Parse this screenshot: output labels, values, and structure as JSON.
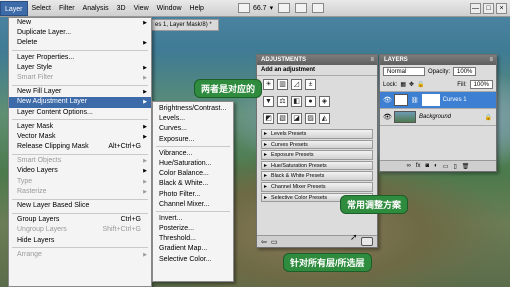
{
  "menubar": {
    "items": [
      "Layer",
      "Select",
      "Filter",
      "Analysis",
      "3D",
      "View",
      "Window",
      "Help"
    ],
    "zoom": "66.7",
    "window_controls": [
      "—",
      "□",
      "×"
    ]
  },
  "doc_tab": "es 1, Layer Mask/8) *",
  "layer_menu": {
    "items": [
      {
        "label": "New",
        "arrow": true
      },
      {
        "label": "Duplicate Layer..."
      },
      {
        "label": "Delete",
        "arrow": true
      },
      {
        "sep": true
      },
      {
        "label": "Layer Properties..."
      },
      {
        "label": "Layer Style",
        "arrow": true
      },
      {
        "label": "Smart Filter",
        "arrow": true,
        "disabled": true
      },
      {
        "sep": true
      },
      {
        "label": "New Fill Layer",
        "arrow": true
      },
      {
        "label": "New Adjustment Layer",
        "arrow": true,
        "highlight": true
      },
      {
        "label": "Layer Content Options..."
      },
      {
        "sep": true
      },
      {
        "label": "Layer Mask",
        "arrow": true
      },
      {
        "label": "Vector Mask",
        "arrow": true
      },
      {
        "label": "Release Clipping Mask",
        "shortcut": "Alt+Ctrl+G"
      },
      {
        "sep": true
      },
      {
        "label": "Smart Objects",
        "arrow": true,
        "disabled": true
      },
      {
        "label": "Video Layers",
        "arrow": true
      },
      {
        "label": "Type",
        "arrow": true,
        "disabled": true
      },
      {
        "label": "Rasterize",
        "arrow": true,
        "disabled": true
      },
      {
        "sep": true
      },
      {
        "label": "New Layer Based Slice"
      },
      {
        "sep": true
      },
      {
        "label": "Group Layers",
        "shortcut": "Ctrl+G"
      },
      {
        "label": "Ungroup Layers",
        "shortcut": "Shift+Ctrl+G",
        "disabled": true
      },
      {
        "label": "Hide Layers"
      },
      {
        "sep": true
      },
      {
        "label": "Arrange",
        "arrow": true,
        "disabled": true
      }
    ]
  },
  "adjustment_submenu": {
    "items": [
      {
        "label": "Brightness/Contrast..."
      },
      {
        "label": "Levels..."
      },
      {
        "label": "Curves..."
      },
      {
        "label": "Exposure..."
      },
      {
        "sep": true
      },
      {
        "label": "Vibrance..."
      },
      {
        "label": "Hue/Saturation..."
      },
      {
        "label": "Color Balance..."
      },
      {
        "label": "Black & White..."
      },
      {
        "label": "Photo Filter..."
      },
      {
        "label": "Channel Mixer..."
      },
      {
        "sep": true
      },
      {
        "label": "Invert..."
      },
      {
        "label": "Posterize..."
      },
      {
        "label": "Threshold..."
      },
      {
        "label": "Gradient Map..."
      },
      {
        "label": "Selective Color..."
      }
    ]
  },
  "adjustments_panel": {
    "title": "ADJUSTMENTS",
    "subtitle": "Add an adjustment",
    "icon_rows": [
      [
        "☀",
        "▥",
        "◿",
        "±"
      ],
      [
        "▼",
        "⚖",
        "◧",
        "●",
        "◈"
      ],
      [
        "◩",
        "▧",
        "◪",
        "▨",
        "◭"
      ]
    ],
    "presets": [
      "Levels Presets",
      "Curves Presets",
      "Exposure Presets",
      "Hue/Saturation Presets",
      "Black & White Presets",
      "Channel Mixer Presets",
      "Selective Color Presets"
    ]
  },
  "layers_panel": {
    "title": "LAYERS",
    "blend_mode": "Normal",
    "opacity_label": "Opacity:",
    "opacity_value": "100%",
    "lock_label": "Lock:",
    "fill_label": "Fill:",
    "fill_value": "100%",
    "layers": [
      {
        "name": "Curves 1",
        "selected": true
      },
      {
        "name": "Background",
        "selected": false
      }
    ],
    "footer_icons": [
      "∞",
      "fx",
      "◙",
      "◐",
      "▭",
      "▯",
      "🗑"
    ]
  },
  "callouts": {
    "mirror": "两者是对应的",
    "presets": "常用调整方案",
    "target": "针对所有层/所选层"
  },
  "colors": {
    "menu_highlight": "#3d6aa8",
    "layer_selected": "#3d7fd2",
    "callout_green": "#2f8c3f"
  }
}
